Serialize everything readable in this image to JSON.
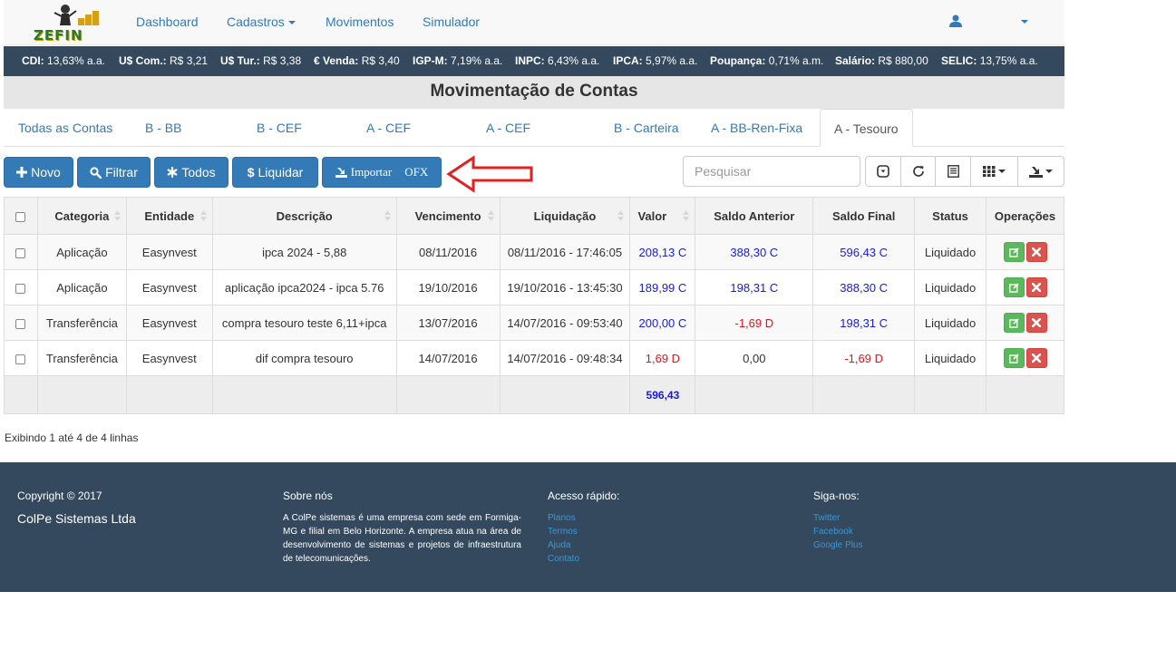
{
  "brand": {
    "name": "ZEFIN"
  },
  "nav": {
    "items": [
      {
        "label": "Dashboard"
      },
      {
        "label": "Cadastros"
      },
      {
        "label": "Movimentos"
      },
      {
        "label": "Simulador"
      }
    ]
  },
  "indicators": [
    {
      "label": "CDI:",
      "value": "13,63% a.a."
    },
    {
      "label": "U$ Com.:",
      "value": "R$ 3,21"
    },
    {
      "label": "U$ Tur.:",
      "value": "R$ 3,38"
    },
    {
      "label": "€ Venda:",
      "value": "R$ 3,40"
    },
    {
      "label": "IGP-M:",
      "value": "7,19% a.a."
    },
    {
      "label": "INPC:",
      "value": "6,43% a.a."
    },
    {
      "label": "IPCA:",
      "value": "5,97% a.a."
    },
    {
      "label": "Poupança:",
      "value": "0,71% a.m."
    },
    {
      "label": "Salário:",
      "value": "R$ 880,00"
    },
    {
      "label": "SELIC:",
      "value": "13,75% a.a."
    }
  ],
  "page": {
    "title": "Movimentação de Contas"
  },
  "tabs": [
    {
      "label": "Todas as Contas"
    },
    {
      "label": "B - BB"
    },
    {
      "label": "B - CEF"
    },
    {
      "label": "A - CEF"
    },
    {
      "label": "A - CEF"
    },
    {
      "label": "B - Carteira"
    },
    {
      "label": "A - BB-Ren-Fixa"
    },
    {
      "label": "A - Tesouro",
      "active": true
    }
  ],
  "toolbar": {
    "novo": "Novo",
    "filtrar": "Filtrar",
    "todos": "Todos",
    "liquidar": "Liquidar",
    "importar": "Importar",
    "ofx": "OFX",
    "search_placeholder": "Pesquisar"
  },
  "table": {
    "headers": [
      "Categoria",
      "Entidade",
      "Descrição",
      "Vencimento",
      "Liquidação",
      "Valor",
      "Saldo Anterior",
      "Saldo Final",
      "Status",
      "Operações"
    ],
    "rows": [
      {
        "categoria": "Aplicação",
        "entidade": "Easynvest",
        "descricao": "ipca 2024 - 5,88",
        "vencimento": "08/11/2016",
        "liquidacao": "08/11/2016 - 17:46:05",
        "valor": "208,13 C",
        "saldo_anterior": "388,30 C",
        "saldo_final": "596,43 C",
        "status": "Liquidado"
      },
      {
        "categoria": "Aplicação",
        "entidade": "Easynvest",
        "descricao": "aplicação ipca2024 - ipca 5.76",
        "vencimento": "19/10/2016",
        "liquidacao": "19/10/2016 - 13:45:30",
        "valor": "189,99 C",
        "saldo_anterior": "198,31 C",
        "saldo_final": "388,30 C",
        "status": "Liquidado"
      },
      {
        "categoria": "Transferência",
        "entidade": "Easynvest",
        "descricao": "compra tesouro teste 6,11+ipca",
        "vencimento": "13/07/2016",
        "liquidacao": "14/07/2016 - 09:53:40",
        "valor": "200,00 C",
        "saldo_anterior": "-1,69 D",
        "saldo_final": "198,31 C",
        "status": "Liquidado"
      },
      {
        "categoria": "Transferência",
        "entidade": "Easynvest",
        "descricao": "dif compra tesouro",
        "vencimento": "14/07/2016",
        "liquidacao": "14/07/2016 - 09:48:34",
        "valor": "1,69 D",
        "saldo_anterior": "0,00",
        "saldo_final": "-1,69 D",
        "status": "Liquidado"
      }
    ],
    "total": "596,43"
  },
  "pagination": {
    "info": "Exibindo 1 até 4 de 4 linhas"
  },
  "footer": {
    "copyright": "Copyright © 2017",
    "company": "ColPe Sistemas Ltda",
    "about_title": "Sobre nós",
    "about_text": "A ColPe sistemas é uma empresa com sede em Formiga-MG e filial em Belo Horizonte. A empresa atua na área de desenvolvimento de sistemas e projetos de infraestrutura de telecomunicações.",
    "quick_title": "Acesso rápido:",
    "quick_links": [
      "Planos",
      "Termos",
      "Ajuda",
      "Contato"
    ],
    "social_title": "Siga-nos:",
    "social_links": [
      "Twitter",
      "Facebook",
      "Google Plus"
    ]
  },
  "colors": {
    "nav_dark": "#34495e",
    "primary": "#337ab7",
    "credit": "#1a1adb",
    "debit": "#e0141e",
    "success": "#5cb85c",
    "danger": "#d9534f",
    "arrow": "#e5201f"
  },
  "icons": [
    "plus-icon",
    "search-icon",
    "asterisk-icon",
    "dollar-icon",
    "import-icon",
    "user-icon",
    "toggle-icon",
    "refresh-icon",
    "list-icon",
    "columns-icon",
    "export-icon",
    "edit-icon",
    "remove-icon",
    "red-arrow-icon"
  ]
}
